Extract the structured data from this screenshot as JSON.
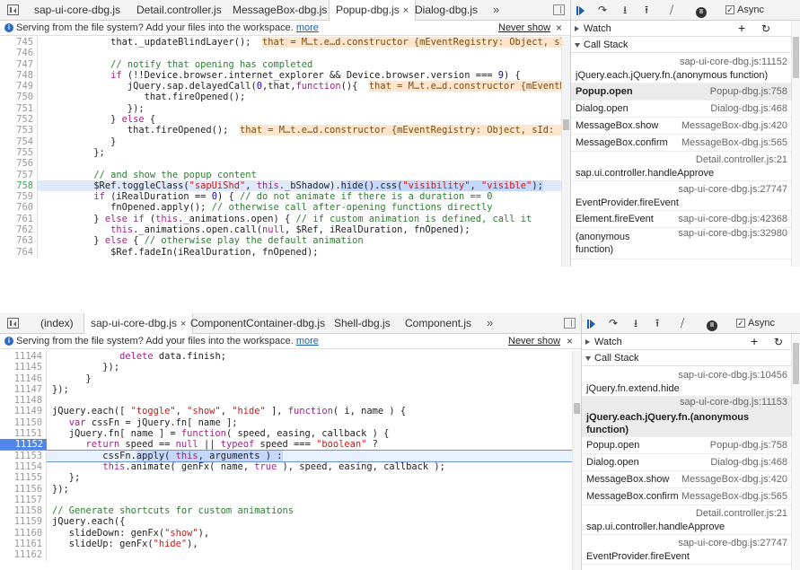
{
  "panel1": {
    "tabs": [
      {
        "label": "sap-ui-core-dbg.js"
      },
      {
        "label": "Detail.controller.js"
      },
      {
        "label": "MessageBox-dbg.js"
      },
      {
        "label": "Popup-dbg.js",
        "active": true,
        "close": "×"
      },
      {
        "label": "Dialog-dbg.js"
      }
    ],
    "tabs_more": "»",
    "infobar": {
      "text": "Serving from the file system? Add your files into the workspace.",
      "link": "more",
      "never_show": "Never show",
      "close": "×"
    },
    "code_lines": [
      {
        "n": "745",
        "html": "            that._updateBlindLayer();  <span class='inline-val'>that = M…t.e…d.constructor {mEventRegistry: Object, sId: '</span>"
      },
      {
        "n": "746",
        "html": ""
      },
      {
        "n": "747",
        "html": "            <span class='cm'>// notify that opening has completed</span>"
      },
      {
        "n": "748",
        "html": "            <span class='kw'>if</span> (!!Device.browser.internet_explorer &amp;&amp; Device.browser.version === <span class='num'>9</span>) {"
      },
      {
        "n": "749",
        "html": "               jQuery.sap.delayedCall(<span class='num'>0</span>,that,<span class='kw'>function</span>(){  <span class='inline-val'>that = M…t.e…d.constructor {mEventReg</span>"
      },
      {
        "n": "750",
        "html": "                  that.fireOpened();"
      },
      {
        "n": "751",
        "html": "               });"
      },
      {
        "n": "752",
        "html": "            } <span class='kw'>else</span> {"
      },
      {
        "n": "753",
        "html": "               that.fireOpened();  <span class='inline-val'>that = M…t.e…d.constructor {mEventRegistry: Object, sId: \"_</span>"
      },
      {
        "n": "754",
        "html": "            }"
      },
      {
        "n": "755",
        "html": "         };"
      },
      {
        "n": "756",
        "html": ""
      },
      {
        "n": "757",
        "html": "         <span class='cm'>// and show the popup content</span>"
      },
      {
        "n": "758",
        "html": "         $Ref.toggleClass(<span class='str'>\"sapUiShd\"</span>, <span class='kw'>this</span>._bShadow).<span class='sel'>hide().css(<span class='str'>\"visibility\"</span>, <span class='str'>\"visible\"</span>);</span>",
        "hl": true
      },
      {
        "n": "759",
        "html": "         <span class='kw'>if</span> (iRealDuration == <span class='num'>0</span>) { <span class='cm'>// do not animate if there is a duration == 0</span>"
      },
      {
        "n": "760",
        "html": "            fnOpened.apply(); <span class='cm'>// otherwise call after-opening functions directly</span>"
      },
      {
        "n": "761",
        "html": "         } <span class='kw'>else if</span> (<span class='kw'>this</span>._animations.open) { <span class='cm'>// if custom animation is defined, call it</span>"
      },
      {
        "n": "762",
        "html": "            <span class='kw'>this</span>._animations.open.call(<span class='kw'>null</span>, $Ref, iRealDuration, fnOpened);"
      },
      {
        "n": "763",
        "html": "         } <span class='kw'>else</span> { <span class='cm'>// otherwise play the default animation</span>"
      },
      {
        "n": "764",
        "html": "            $Ref.fadeIn(iRealDuration, fnOpened);"
      }
    ],
    "sidebar": {
      "async_label": "Async",
      "async_check": "✓",
      "watch_label": "Watch",
      "watch_add": "+",
      "watch_refresh": "↻",
      "callstack_label": "Call Stack",
      "frames": [
        {
          "fn": "jQuery.each.jQuery.fn.(anonymous function)",
          "loc": "sap-ui-core-dbg.js:11152",
          "kind": "double"
        },
        {
          "fn": "Popup.open",
          "loc": "Popup-dbg.js:758",
          "kind": "single",
          "current": true
        },
        {
          "fn": "Dialog.open",
          "loc": "Dialog-dbg.js:468",
          "kind": "single"
        },
        {
          "fn": "MessageBox.show",
          "loc": "MessageBox-dbg.js:420",
          "kind": "single"
        },
        {
          "fn": "MessageBox.confirm",
          "loc": "MessageBox-dbg.js:565",
          "kind": "single"
        },
        {
          "fn": "sap.ui.controller.handleApprove",
          "loc": "Detail.controller.js:21",
          "kind": "double"
        },
        {
          "fn": "EventProvider.fireEvent",
          "loc": "sap-ui-core-dbg.js:27747",
          "kind": "double"
        },
        {
          "fn": "Element.fireEvent",
          "loc": "sap-ui-core-dbg.js:42368",
          "kind": "single"
        },
        {
          "fn": "(anonymous function)",
          "loc": "sap-ui-core-dbg.js:32980",
          "kind": "wrap"
        }
      ]
    }
  },
  "panel2": {
    "tabs": [
      {
        "label": "(index)"
      },
      {
        "label": "sap-ui-core-dbg.js",
        "active": true,
        "close": "×"
      },
      {
        "label": "ComponentContainer-dbg.js"
      },
      {
        "label": "Shell-dbg.js"
      },
      {
        "label": "Component.js"
      }
    ],
    "tabs_more": "»",
    "infobar": {
      "text": "Serving from the file system? Add your files into the workspace.",
      "link": "more",
      "never_show": "Never show",
      "close": "×"
    },
    "code_lines": [
      {
        "n": "11144",
        "html": "            <span class='kw'>delete</span> data.finish;"
      },
      {
        "n": "11145",
        "html": "         });"
      },
      {
        "n": "11146",
        "html": "      }"
      },
      {
        "n": "11147",
        "html": "});"
      },
      {
        "n": "11148",
        "html": ""
      },
      {
        "n": "11149",
        "html": "jQuery.each([ <span class='str'>\"toggle\"</span>, <span class='str'>\"show\"</span>, <span class='str'>\"hide\"</span> ], <span class='kw'>function</span>( i, name ) {"
      },
      {
        "n": "11150",
        "html": "   <span class='kw'>var</span> cssFn = jQuery.fn[ name ];"
      },
      {
        "n": "11151",
        "html": "   jQuery.fn[ name ] = <span class='kw'>function</span>( speed, easing, callback ) {"
      },
      {
        "n": "11152",
        "html": "      <span class='kw'>return</span> speed == <span class='kw'>null</span> || <span class='kw'>typeof</span> speed === <span class='str'>\"boolean\"</span> ?",
        "bp": true
      },
      {
        "n": "11153",
        "html": "         cssFn.<span class='sel'>apply( <span class='kw'>this</span>, arguments ) :</span>",
        "cur": true
      },
      {
        "n": "11154",
        "html": "         <span class='kw'>this</span>.animate( genFx( name, <span class='kw'>true</span> ), speed, easing, callback );"
      },
      {
        "n": "11155",
        "html": "   };"
      },
      {
        "n": "11156",
        "html": "});"
      },
      {
        "n": "11157",
        "html": ""
      },
      {
        "n": "11158",
        "html": "<span class='cm'>// Generate shortcuts for custom animations</span>"
      },
      {
        "n": "11159",
        "html": "jQuery.each({"
      },
      {
        "n": "11160",
        "html": "   slideDown: genFx(<span class='str'>\"show\"</span>),"
      },
      {
        "n": "11161",
        "html": "   slideUp: genFx(<span class='str'>\"hide\"</span>),"
      },
      {
        "n": "11162",
        "html": ""
      }
    ],
    "sidebar": {
      "async_label": "Async",
      "async_check": "✓",
      "watch_label": "Watch",
      "watch_add": "+",
      "watch_refresh": "↻",
      "callstack_label": "Call Stack",
      "frames": [
        {
          "fn": "jQuery.fn.extend.hide",
          "loc": "sap-ui-core-dbg.js:10456",
          "kind": "double"
        },
        {
          "fn": "jQuery.each.jQuery.fn.(anonymous function)",
          "loc": "sap-ui-core-dbg.js:11153",
          "kind": "tall",
          "current": true
        },
        {
          "fn": "Popup.open",
          "loc": "Popup-dbg.js:758",
          "kind": "single"
        },
        {
          "fn": "Dialog.open",
          "loc": "Dialog-dbg.js:468",
          "kind": "single"
        },
        {
          "fn": "MessageBox.show",
          "loc": "MessageBox-dbg.js:420",
          "kind": "single"
        },
        {
          "fn": "MessageBox.confirm",
          "loc": "MessageBox-dbg.js:565",
          "kind": "single"
        },
        {
          "fn": "sap.ui.controller.handleApprove",
          "loc": "Detail.controller.js:21",
          "kind": "double"
        },
        {
          "fn": "EventProvider.fireEvent",
          "loc": "sap-ui-core-dbg.js:27747",
          "kind": "double"
        }
      ]
    }
  }
}
